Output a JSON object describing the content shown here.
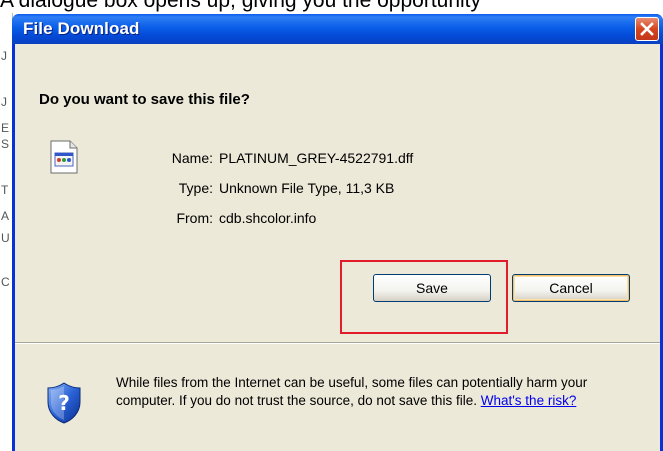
{
  "caption": "A dialogue box opens up, giving you the opportunity",
  "left_strip_letters": [
    "J",
    "J",
    "E",
    "S",
    "T",
    "A",
    "U",
    "C"
  ],
  "dialog": {
    "title": "File Download",
    "question": "Do you want to save this file?",
    "file": {
      "name_label": "Name:",
      "name_value": "PLATINUM_GREY-4522791.dff",
      "type_label": "Type:",
      "type_value": "Unknown File Type, 11,3 KB",
      "from_label": "From:",
      "from_value": "cdb.shcolor.info"
    },
    "buttons": {
      "save": "Save",
      "cancel": "Cancel"
    },
    "warning": {
      "text": "While files from the Internet can be useful, some files can potentially harm your computer. If you do not trust the source, do not save this file.",
      "link": "What's the risk?"
    }
  },
  "icons": {
    "close": "close-icon",
    "file": "unknown-file-icon",
    "shield": "security-shield-question-icon"
  },
  "colors": {
    "titlebar": "#0a5ee8",
    "window_border": "#0831d9",
    "client_bg": "#ece9d8",
    "highlight": "#e21d2b",
    "close_button": "#d5461f",
    "link": "#0000ee"
  }
}
